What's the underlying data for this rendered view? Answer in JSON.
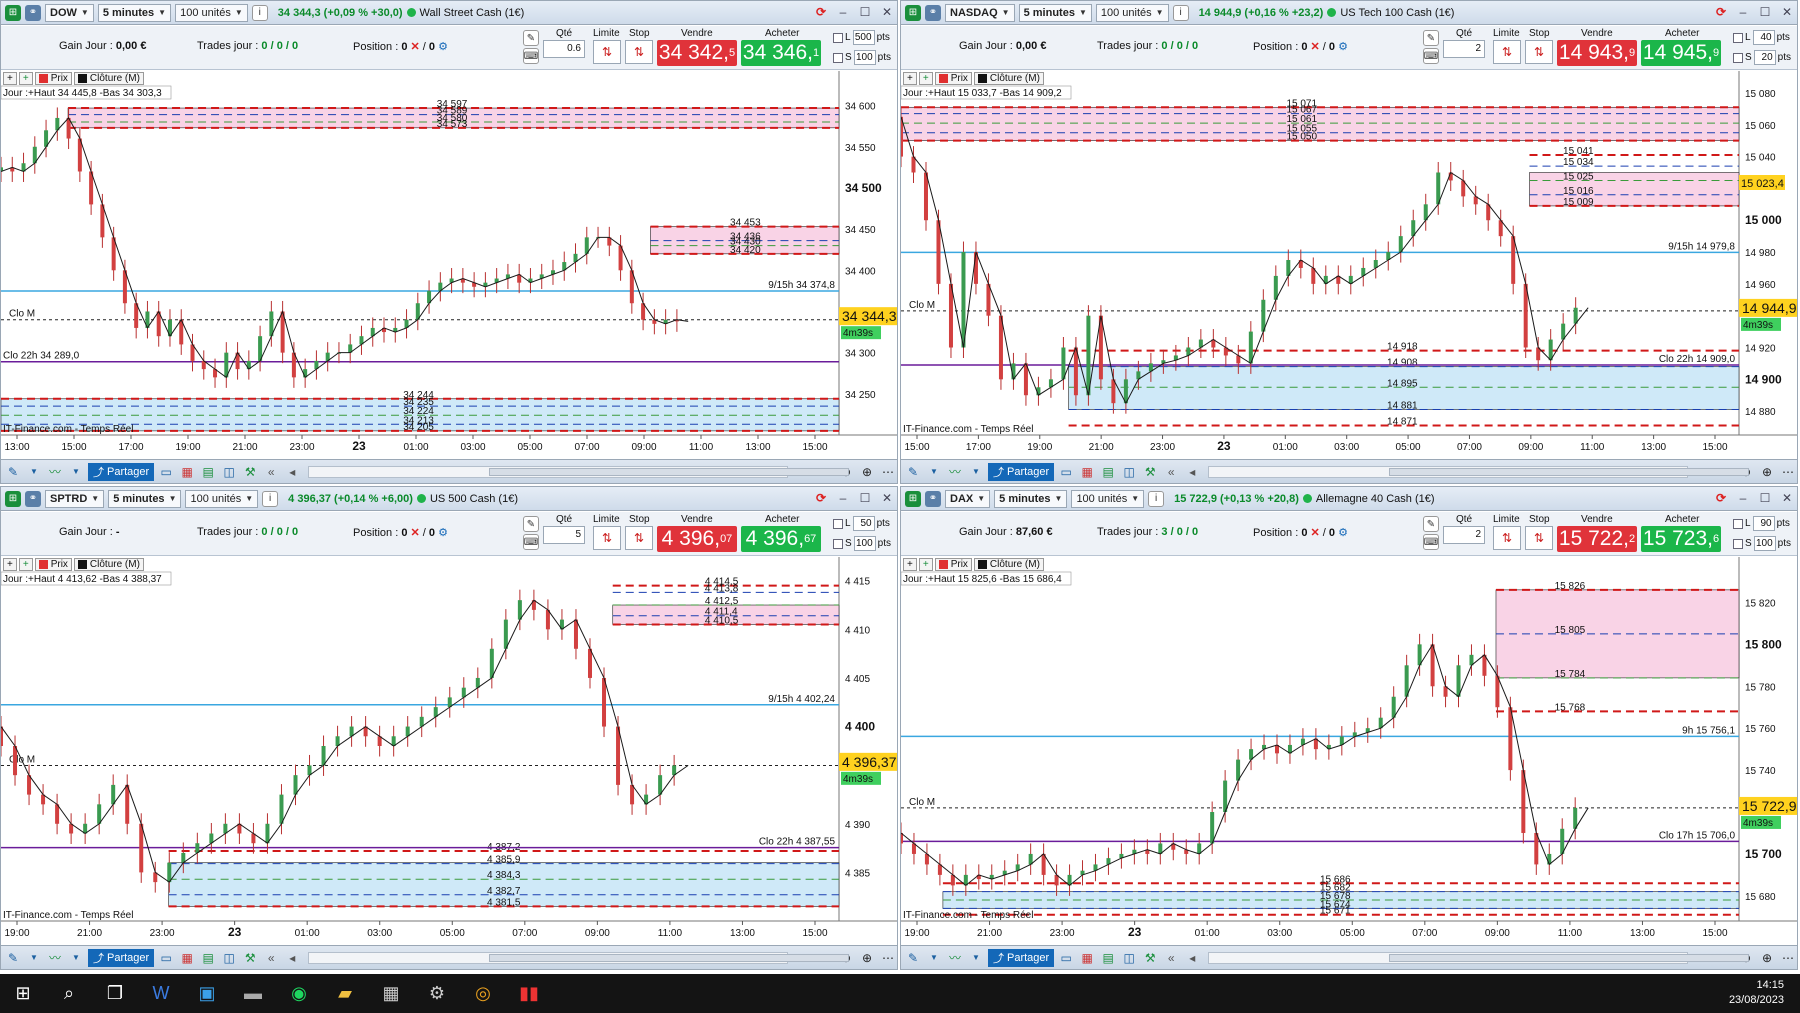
{
  "common": {
    "gain_label": "Gain Jour :",
    "trades_label": "Trades jour :",
    "position_label": "Position :",
    "qty_label": "Qté",
    "limit_label": "Limite",
    "stop_label": "Stop",
    "sell_label": "Vendre",
    "buy_label": "Acheter",
    "pts": "pts",
    "prix": "Prix",
    "cloture": "Clôture (M)",
    "source": "IT-Finance.com - Temps Réel",
    "share": "Partager",
    "clo_m": "Clo M",
    "timer": "4m39s"
  },
  "panes": [
    {
      "symbol": "DOW",
      "timeframe": "5 minutes",
      "units": "100 unités",
      "quote": "34 344,3 (+0,09 % +30,0)",
      "instrument": "Wall Street Cash (1€)",
      "gain": "0,00 €",
      "trades": "0 / 0 / 0",
      "position": "0",
      "qty": "0.6",
      "sell_main": "34 342,",
      "sell_dec": "5",
      "buy_main": "34 346,",
      "buy_dec": "1",
      "limit_pts": "500",
      "stop_pts": "100",
      "header_text": "Jour :+Haut 34 445,8 -Bas 34 303,3",
      "last_price": "34 344,3",
      "last_price_val": 34344.3,
      "ymin": 34200,
      "ymax": 34625,
      "yticks": [
        {
          "v": 34600,
          "t": "34 600"
        },
        {
          "v": 34550,
          "t": "34 550"
        },
        {
          "v": 34500,
          "t": "34 500",
          "bold": true
        },
        {
          "v": 34450,
          "t": "34 450"
        },
        {
          "v": 34400,
          "t": "34 400"
        },
        {
          "v": 34300,
          "t": "34 300"
        },
        {
          "v": 34250,
          "t": "34 250"
        }
      ],
      "xticks": [
        "13:00",
        "15:00",
        "17:00",
        "19:00",
        "21:00",
        "23:00",
        "23",
        "01:00",
        "03:00",
        "05:00",
        "07:00",
        "09:00",
        "11:00",
        "13:00",
        "15:00"
      ],
      "zones": [
        {
          "y1": 34597,
          "y2": 34573,
          "x1": 0.08,
          "color": "#f9d3e6",
          "labels": [
            "34 597",
            "34 589",
            "34 580",
            "34 573"
          ],
          "lx": 0.52
        },
        {
          "y1": 34453,
          "y2": 34420,
          "x1": 0.775,
          "color": "#f9d3e6",
          "labels": [
            "34 453",
            "34 436",
            "34 430",
            "34 420"
          ],
          "lx": 0.87
        },
        {
          "y1": 34244,
          "y2": 34205,
          "x1": 0.0,
          "color": "#cfe9f8",
          "labels": [
            "34 244",
            "34 235",
            "34 224",
            "34 213",
            "34 205"
          ],
          "lx": 0.48
        }
      ],
      "hlines": [
        {
          "v": 34374.8,
          "color": "#3aa7e0",
          "label": "9/15h 34 374,8"
        },
        {
          "v": 34289.0,
          "color": "#6a1c9a",
          "label": "Clo 22h 34 289,0",
          "lpos": "left"
        }
      ],
      "clo_m_val": 34340,
      "path": [
        34520,
        34525,
        34520,
        34530,
        34550,
        34570,
        34585,
        34560,
        34520,
        34480,
        34440,
        34400,
        34360,
        34330,
        34350,
        34320,
        34340,
        34310,
        34290,
        34280,
        34270,
        34300,
        34280,
        34290,
        34320,
        34350,
        34300,
        34270,
        34280,
        34290,
        34300,
        34300,
        34310,
        34320,
        34330,
        34325,
        34330,
        34340,
        34360,
        34375,
        34385,
        34390,
        34385,
        34380,
        34385,
        34390,
        34395,
        34385,
        34390,
        34395,
        34400,
        34410,
        34420,
        34440,
        34440,
        34430,
        34400,
        34360,
        34340,
        34335,
        34340,
        34338
      ],
      "path_end": 0.82
    },
    {
      "symbol": "NASDAQ",
      "timeframe": "5 minutes",
      "units": "100 unités",
      "quote": "14 944,9 (+0,16 % +23,2)",
      "instrument": "US Tech 100 Cash (1€)",
      "gain": "0,00 €",
      "trades": "0 / 0 / 0",
      "position": "0",
      "qty": "2",
      "sell_main": "14 943,",
      "sell_dec": "9",
      "buy_main": "14 945,",
      "buy_dec": "9",
      "limit_pts": "40",
      "stop_pts": "20",
      "header_text": "Jour :+Haut 15 033,7 -Bas 14 909,2",
      "last_price": "14 944,9",
      "last_price_val": 14944.9,
      "extra_tag": "15 023,4",
      "extra_tag_val": 15023.4,
      "ymin": 14865,
      "ymax": 15085,
      "yticks": [
        {
          "v": 15080,
          "t": "15 080"
        },
        {
          "v": 15060,
          "t": "15 060"
        },
        {
          "v": 15040,
          "t": "15 040"
        },
        {
          "v": 15000,
          "t": "15 000",
          "bold": true
        },
        {
          "v": 14980,
          "t": "14 980"
        },
        {
          "v": 14960,
          "t": "14 960"
        },
        {
          "v": 14920,
          "t": "14 920"
        },
        {
          "v": 14900,
          "t": "14 900",
          "bold": true
        },
        {
          "v": 14880,
          "t": "14 880"
        }
      ],
      "xticks": [
        "15:00",
        "17:00",
        "19:00",
        "21:00",
        "23:00",
        "23",
        "01:00",
        "03:00",
        "05:00",
        "07:00",
        "09:00",
        "11:00",
        "13:00",
        "15:00"
      ],
      "zones": [
        {
          "y1": 15071,
          "y2": 15050,
          "x1": 0.0,
          "color": "#f9d3e6",
          "labels": [
            "15 071",
            "15 067",
            "15 061",
            "15 055",
            "15 050"
          ],
          "lx": 0.46
        },
        {
          "y1": 15030,
          "y2": 15009,
          "x1": 0.75,
          "color": "#f9d3e6",
          "labels": [
            "15 041",
            "15 034",
            "15 025",
            "15 016",
            "15 009"
          ],
          "lx": 0.79
        },
        {
          "y1": 14908,
          "y2": 14881,
          "x1": 0.2,
          "color": "#cfe9f8",
          "labels": [
            "14 918",
            "14 908",
            "14 895",
            "14 881",
            "14 871"
          ],
          "lx": 0.58
        }
      ],
      "hlines": [
        {
          "v": 14979.8,
          "color": "#3aa7e0",
          "label": "9/15h 14 979,8"
        },
        {
          "v": 14909.0,
          "color": "#6a1c9a",
          "label": "Clo 22h 14 909,0"
        }
      ],
      "clo_m_val": 14943,
      "path": [
        15065,
        15040,
        15030,
        15000,
        14960,
        14920,
        14980,
        14960,
        14940,
        14900,
        14910,
        14890,
        14895,
        14900,
        14920,
        14890,
        14940,
        14900,
        14885,
        14900,
        14905,
        14910,
        14912,
        14915,
        14920,
        14925,
        14920,
        14915,
        14910,
        14930,
        14950,
        14965,
        14975,
        14970,
        14960,
        14965,
        14960,
        14965,
        14970,
        14975,
        14980,
        14990,
        15000,
        15010,
        15030,
        15025,
        15015,
        15010,
        15000,
        14990,
        14960,
        14920,
        14912,
        14925,
        14935,
        14945
      ],
      "path_end": 0.82
    },
    {
      "symbol": "SPTRD",
      "timeframe": "5 minutes",
      "units": "100 unités",
      "quote": "4 396,37 (+0,14 % +6,00)",
      "instrument": "US 500 Cash (1€)",
      "gain": "-",
      "trades": "0 / 0 / 0",
      "position": "0",
      "qty": "5",
      "sell_main": "4 396,",
      "sell_dec": "07",
      "buy_main": "4 396,",
      "buy_dec": "67",
      "limit_pts": "50",
      "stop_pts": "100",
      "header_text": "Jour :+Haut 4 413,62 -Bas 4 388,37",
      "last_price": "4 396,37",
      "last_price_val": 4396.37,
      "ymin": 4380,
      "ymax": 4416,
      "yticks": [
        {
          "v": 4415,
          "t": "4 415"
        },
        {
          "v": 4410,
          "t": "4 410"
        },
        {
          "v": 4405,
          "t": "4 405"
        },
        {
          "v": 4400,
          "t": "4 400",
          "bold": true
        },
        {
          "v": 4390,
          "t": "4 390"
        },
        {
          "v": 4385,
          "t": "4 385"
        }
      ],
      "xticks": [
        "19:00",
        "21:00",
        "23:00",
        "23",
        "01:00",
        "03:00",
        "05:00",
        "07:00",
        "09:00",
        "11:00",
        "13:00",
        "15:00"
      ],
      "zones": [
        {
          "y1": 4412.5,
          "y2": 4410.5,
          "x1": 0.73,
          "color": "#f9d3e6",
          "labels": [
            "4 414,5",
            "4 413,8",
            "4 412,5",
            "4 411,4",
            "4 410,5"
          ],
          "lx": 0.84
        },
        {
          "y1": 4386.0,
          "y2": 4381.5,
          "x1": 0.2,
          "color": "#cfe9f8",
          "labels": [
            "4 387,2",
            "4 385,9",
            "4 384,3",
            "4 382,7",
            "4 381,5"
          ],
          "lx": 0.58
        }
      ],
      "hlines": [
        {
          "v": 4402.24,
          "color": "#3aa7e0",
          "label": "9/15h 4 402,24"
        },
        {
          "v": 4387.55,
          "color": "#6a1c9a",
          "label": "Clo 22h 4 387,55"
        }
      ],
      "clo_m_val": 4396.0,
      "path": [
        4400,
        4398,
        4395,
        4393,
        4392,
        4390,
        4389,
        4390,
        4392,
        4394,
        4390,
        4385,
        4384,
        4386,
        4387,
        4388,
        4389,
        4390,
        4389,
        4388,
        4390,
        4393,
        4395,
        4396,
        4398,
        4399,
        4400,
        4399,
        4398,
        4399,
        4400,
        4401,
        4402,
        4403,
        4404,
        4405,
        4408,
        4411,
        4413,
        4412,
        4410,
        4411,
        4408,
        4405,
        4400,
        4394,
        4392,
        4393,
        4395,
        4396
      ],
      "path_end": 0.82
    },
    {
      "symbol": "DAX",
      "timeframe": "5 minutes",
      "units": "100 unités",
      "quote": "15 722,9 (+0,13 % +20,8)",
      "instrument": "Allemagne 40 Cash (1€)",
      "gain": "87,60 €",
      "trades": "3 / 0 / 0",
      "position": "0",
      "qty": "2",
      "sell_main": "15 722,",
      "sell_dec": "2",
      "buy_main": "15 723,",
      "buy_dec": "6",
      "limit_pts": "90",
      "stop_pts": "100",
      "header_text": "Jour :+Haut 15 825,6 -Bas 15 686,4",
      "last_price": "15 722,9",
      "last_price_val": 15722.9,
      "ymin": 15668,
      "ymax": 15835,
      "yticks": [
        {
          "v": 15820,
          "t": "15 820"
        },
        {
          "v": 15800,
          "t": "15 800",
          "bold": true
        },
        {
          "v": 15780,
          "t": "15 780"
        },
        {
          "v": 15760,
          "t": "15 760"
        },
        {
          "v": 15740,
          "t": "15 740"
        },
        {
          "v": 15700,
          "t": "15 700",
          "bold": true
        },
        {
          "v": 15680,
          "t": "15 680"
        }
      ],
      "xticks": [
        "19:00",
        "21:00",
        "23:00",
        "23",
        "01:00",
        "03:00",
        "05:00",
        "07:00",
        "09:00",
        "11:00",
        "13:00",
        "15:00"
      ],
      "zones": [
        {
          "y1": 15826,
          "y2": 15784,
          "x1": 0.71,
          "color": "#f9d3e6",
          "labels": [
            "15 826",
            "15 805",
            "15 784",
            "15 768"
          ],
          "lx": 0.78
        },
        {
          "y1": 15682,
          "y2": 15674,
          "x1": 0.05,
          "color": "#cfe9f8",
          "labels": [
            "15 686",
            "15 682",
            "15 678",
            "15 674",
            "15 671"
          ],
          "lx": 0.5
        }
      ],
      "hlines": [
        {
          "v": 15756.1,
          "color": "#3aa7e0",
          "label": "9h 15 756,1"
        },
        {
          "v": 15706.0,
          "color": "#6a1c9a",
          "label": "Clo 17h 15 706,0"
        }
      ],
      "clo_m_val": 15722,
      "path": [
        15710,
        15705,
        15700,
        15695,
        15690,
        15685,
        15690,
        15688,
        15690,
        15692,
        15695,
        15700,
        15690,
        15685,
        15690,
        15692,
        15695,
        15698,
        15700,
        15702,
        15700,
        15705,
        15702,
        15700,
        15705,
        15720,
        15735,
        15745,
        15750,
        15752,
        15748,
        15752,
        15755,
        15750,
        15752,
        15756,
        15758,
        15760,
        15765,
        15775,
        15790,
        15800,
        15780,
        15775,
        15790,
        15795,
        15785,
        15770,
        15740,
        15710,
        15695,
        15700,
        15712,
        15722
      ],
      "path_end": 0.82
    }
  ],
  "taskbar": {
    "time": "14:15",
    "date": "23/08/2023"
  }
}
